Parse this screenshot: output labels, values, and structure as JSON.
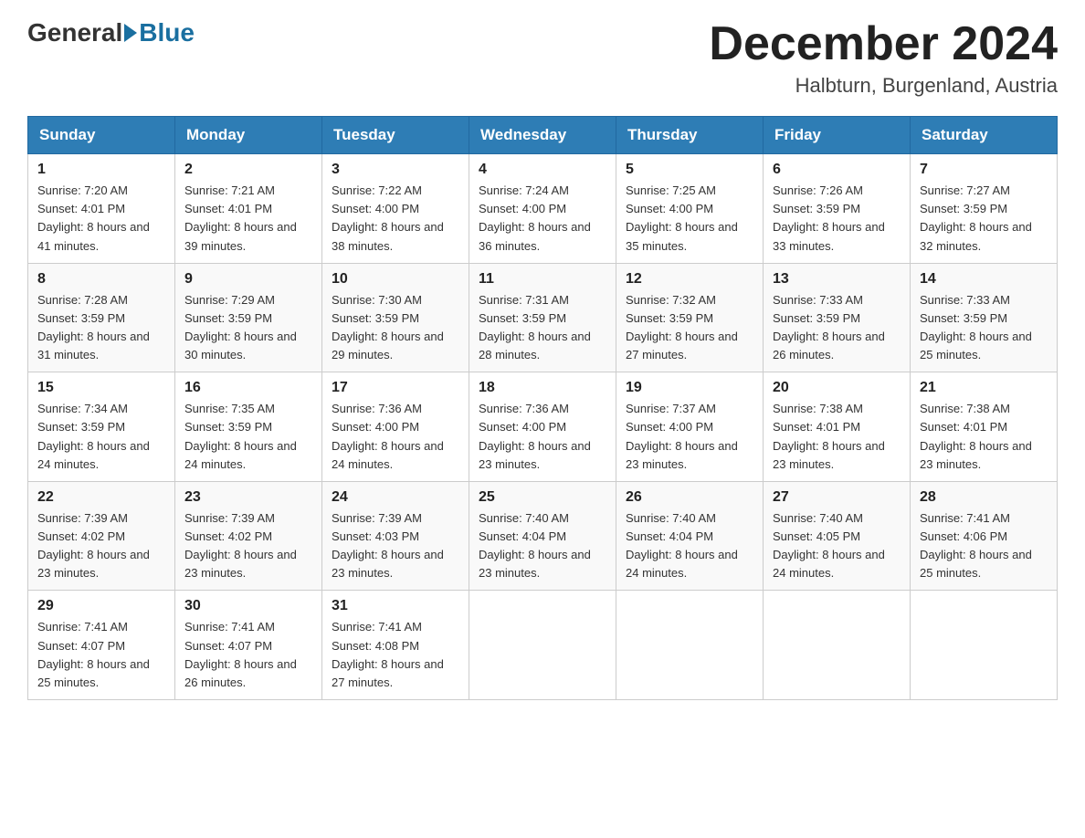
{
  "header": {
    "logo_general": "General",
    "logo_blue": "Blue",
    "month_title": "December 2024",
    "location": "Halbturn, Burgenland, Austria"
  },
  "weekdays": [
    "Sunday",
    "Monday",
    "Tuesday",
    "Wednesday",
    "Thursday",
    "Friday",
    "Saturday"
  ],
  "weeks": [
    [
      {
        "day": "1",
        "sunrise": "7:20 AM",
        "sunset": "4:01 PM",
        "daylight": "8 hours and 41 minutes."
      },
      {
        "day": "2",
        "sunrise": "7:21 AM",
        "sunset": "4:01 PM",
        "daylight": "8 hours and 39 minutes."
      },
      {
        "day": "3",
        "sunrise": "7:22 AM",
        "sunset": "4:00 PM",
        "daylight": "8 hours and 38 minutes."
      },
      {
        "day": "4",
        "sunrise": "7:24 AM",
        "sunset": "4:00 PM",
        "daylight": "8 hours and 36 minutes."
      },
      {
        "day": "5",
        "sunrise": "7:25 AM",
        "sunset": "4:00 PM",
        "daylight": "8 hours and 35 minutes."
      },
      {
        "day": "6",
        "sunrise": "7:26 AM",
        "sunset": "3:59 PM",
        "daylight": "8 hours and 33 minutes."
      },
      {
        "day": "7",
        "sunrise": "7:27 AM",
        "sunset": "3:59 PM",
        "daylight": "8 hours and 32 minutes."
      }
    ],
    [
      {
        "day": "8",
        "sunrise": "7:28 AM",
        "sunset": "3:59 PM",
        "daylight": "8 hours and 31 minutes."
      },
      {
        "day": "9",
        "sunrise": "7:29 AM",
        "sunset": "3:59 PM",
        "daylight": "8 hours and 30 minutes."
      },
      {
        "day": "10",
        "sunrise": "7:30 AM",
        "sunset": "3:59 PM",
        "daylight": "8 hours and 29 minutes."
      },
      {
        "day": "11",
        "sunrise": "7:31 AM",
        "sunset": "3:59 PM",
        "daylight": "8 hours and 28 minutes."
      },
      {
        "day": "12",
        "sunrise": "7:32 AM",
        "sunset": "3:59 PM",
        "daylight": "8 hours and 27 minutes."
      },
      {
        "day": "13",
        "sunrise": "7:33 AM",
        "sunset": "3:59 PM",
        "daylight": "8 hours and 26 minutes."
      },
      {
        "day": "14",
        "sunrise": "7:33 AM",
        "sunset": "3:59 PM",
        "daylight": "8 hours and 25 minutes."
      }
    ],
    [
      {
        "day": "15",
        "sunrise": "7:34 AM",
        "sunset": "3:59 PM",
        "daylight": "8 hours and 24 minutes."
      },
      {
        "day": "16",
        "sunrise": "7:35 AM",
        "sunset": "3:59 PM",
        "daylight": "8 hours and 24 minutes."
      },
      {
        "day": "17",
        "sunrise": "7:36 AM",
        "sunset": "4:00 PM",
        "daylight": "8 hours and 24 minutes."
      },
      {
        "day": "18",
        "sunrise": "7:36 AM",
        "sunset": "4:00 PM",
        "daylight": "8 hours and 23 minutes."
      },
      {
        "day": "19",
        "sunrise": "7:37 AM",
        "sunset": "4:00 PM",
        "daylight": "8 hours and 23 minutes."
      },
      {
        "day": "20",
        "sunrise": "7:38 AM",
        "sunset": "4:01 PM",
        "daylight": "8 hours and 23 minutes."
      },
      {
        "day": "21",
        "sunrise": "7:38 AM",
        "sunset": "4:01 PM",
        "daylight": "8 hours and 23 minutes."
      }
    ],
    [
      {
        "day": "22",
        "sunrise": "7:39 AM",
        "sunset": "4:02 PM",
        "daylight": "8 hours and 23 minutes."
      },
      {
        "day": "23",
        "sunrise": "7:39 AM",
        "sunset": "4:02 PM",
        "daylight": "8 hours and 23 minutes."
      },
      {
        "day": "24",
        "sunrise": "7:39 AM",
        "sunset": "4:03 PM",
        "daylight": "8 hours and 23 minutes."
      },
      {
        "day": "25",
        "sunrise": "7:40 AM",
        "sunset": "4:04 PM",
        "daylight": "8 hours and 23 minutes."
      },
      {
        "day": "26",
        "sunrise": "7:40 AM",
        "sunset": "4:04 PM",
        "daylight": "8 hours and 24 minutes."
      },
      {
        "day": "27",
        "sunrise": "7:40 AM",
        "sunset": "4:05 PM",
        "daylight": "8 hours and 24 minutes."
      },
      {
        "day": "28",
        "sunrise": "7:41 AM",
        "sunset": "4:06 PM",
        "daylight": "8 hours and 25 minutes."
      }
    ],
    [
      {
        "day": "29",
        "sunrise": "7:41 AM",
        "sunset": "4:07 PM",
        "daylight": "8 hours and 25 minutes."
      },
      {
        "day": "30",
        "sunrise": "7:41 AM",
        "sunset": "4:07 PM",
        "daylight": "8 hours and 26 minutes."
      },
      {
        "day": "31",
        "sunrise": "7:41 AM",
        "sunset": "4:08 PM",
        "daylight": "8 hours and 27 minutes."
      },
      null,
      null,
      null,
      null
    ]
  ]
}
